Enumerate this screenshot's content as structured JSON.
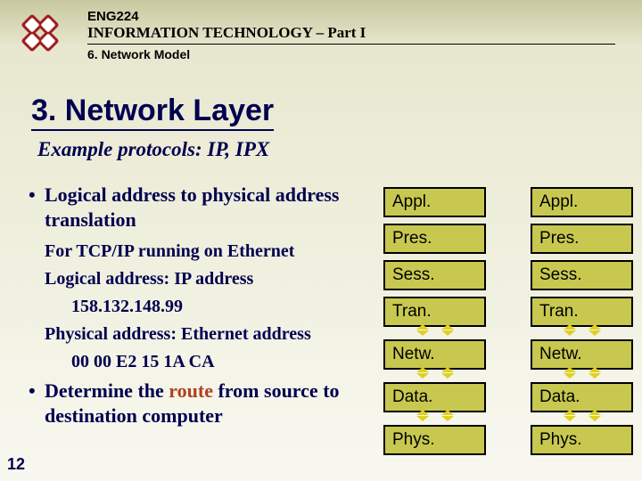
{
  "header": {
    "course_code": "ENG224",
    "course_title": "INFORMATION TECHNOLOGY – Part I",
    "subtitle": "6. Network Model"
  },
  "section_title": "3. Network Layer",
  "example": "Example protocols: IP, IPX",
  "bullets": {
    "b1": "Logical address to physical address translation",
    "s1": "For TCP/IP running on Ethernet",
    "s2": "Logical address: IP address",
    "ip": "158.132.148.99",
    "s3": "Physical address: Ethernet address",
    "mac": "00 00 E2 15 1A CA",
    "b2a": "Determine the ",
    "b2route": "route",
    "b2b": " from source to destination computer"
  },
  "layers": [
    "Appl.",
    "Pres.",
    "Sess.",
    "Tran.",
    "Netw.",
    "Data.",
    "Phys."
  ],
  "page": "12"
}
